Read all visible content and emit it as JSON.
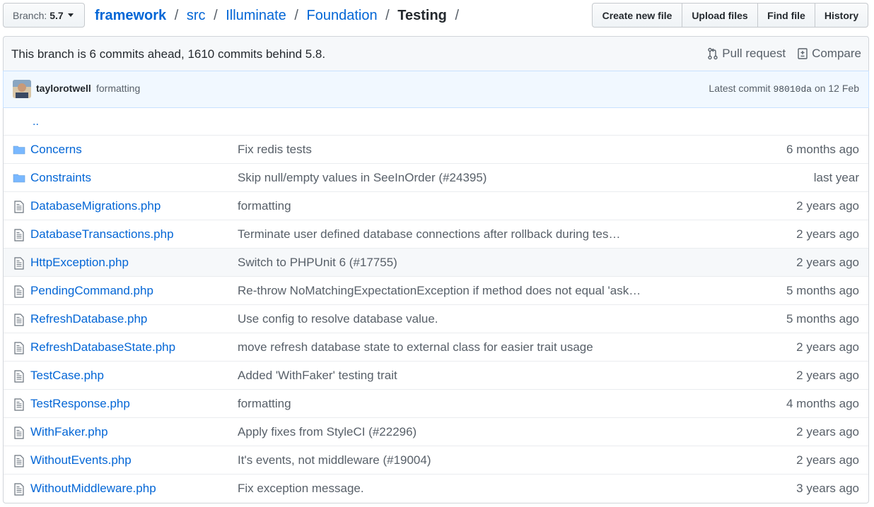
{
  "branch": {
    "prefix": "Branch:",
    "name": "5.7"
  },
  "breadcrumb": {
    "items": [
      "framework",
      "src",
      "Illuminate",
      "Foundation"
    ],
    "current": "Testing",
    "separator": "/"
  },
  "actions": [
    "Create new file",
    "Upload files",
    "Find file",
    "History"
  ],
  "compare": {
    "text": "This branch is 6 commits ahead, 1610 commits behind 5.8.",
    "pull_request": "Pull request",
    "compare": "Compare"
  },
  "commit": {
    "author": "taylorotwell",
    "message": "formatting",
    "latest_prefix": "Latest commit",
    "sha": "98010da",
    "date": "on 12 Feb"
  },
  "parent_link": "..",
  "files": [
    {
      "type": "folder",
      "name": "Concerns",
      "message": "Fix redis tests",
      "age": "6 months ago"
    },
    {
      "type": "folder",
      "name": "Constraints",
      "message": "Skip null/empty values in SeeInOrder (#24395)",
      "age": "last year"
    },
    {
      "type": "file",
      "name": "DatabaseMigrations.php",
      "message": "formatting",
      "age": "2 years ago"
    },
    {
      "type": "file",
      "name": "DatabaseTransactions.php",
      "message": "Terminate user defined database connections after rollback during tes…",
      "age": "2 years ago"
    },
    {
      "type": "file",
      "name": "HttpException.php",
      "message": "Switch to PHPUnit 6 (#17755)",
      "age": "2 years ago"
    },
    {
      "type": "file",
      "name": "PendingCommand.php",
      "message": "Re-throw NoMatchingExpectationException if method does not equal 'ask…",
      "age": "5 months ago"
    },
    {
      "type": "file",
      "name": "RefreshDatabase.php",
      "message": "Use config to resolve database value.",
      "age": "5 months ago"
    },
    {
      "type": "file",
      "name": "RefreshDatabaseState.php",
      "message": "move refresh database state to external class for easier trait usage",
      "age": "2 years ago"
    },
    {
      "type": "file",
      "name": "TestCase.php",
      "message": "Added 'WithFaker' testing trait",
      "age": "2 years ago"
    },
    {
      "type": "file",
      "name": "TestResponse.php",
      "message": "formatting",
      "age": "4 months ago"
    },
    {
      "type": "file",
      "name": "WithFaker.php",
      "message": "Apply fixes from StyleCI (#22296)",
      "age": "2 years ago"
    },
    {
      "type": "file",
      "name": "WithoutEvents.php",
      "message": "It's events, not middleware (#19004)",
      "age": "2 years ago"
    },
    {
      "type": "file",
      "name": "WithoutMiddleware.php",
      "message": "Fix exception message.",
      "age": "3 years ago"
    }
  ],
  "colors": {
    "link": "#0366d6",
    "muted": "#586069",
    "folder": "#79b8ff"
  }
}
